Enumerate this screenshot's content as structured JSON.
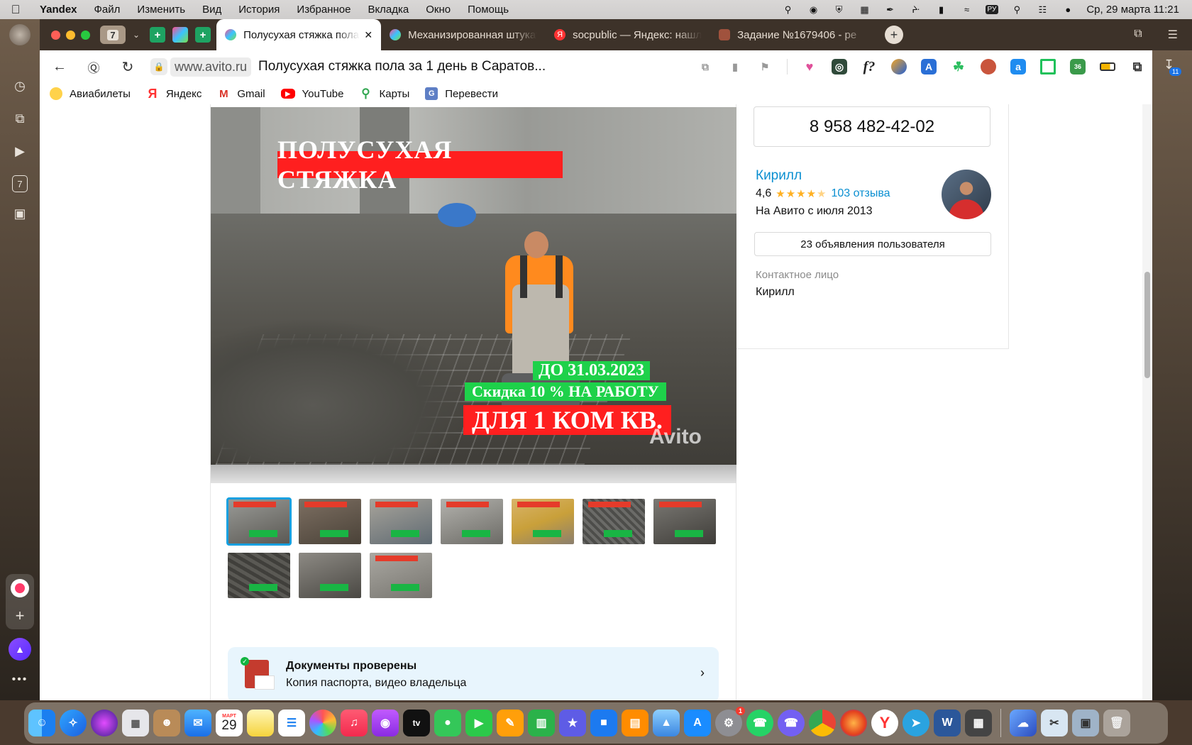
{
  "menubar": {
    "app_name": "Yandex",
    "items": [
      "Файл",
      "Изменить",
      "Вид",
      "История",
      "Избранное",
      "Вкладка",
      "Окно",
      "Помощь"
    ],
    "keyboard_layout": "РУ",
    "datetime": "Ср, 29 марта  11:21"
  },
  "tabs": {
    "count": "7",
    "items": [
      {
        "title": "Полусухая стяжка пола",
        "active": true
      },
      {
        "title": "Механизированная штукатурка",
        "active": false
      },
      {
        "title": "socpublic — Яндекс: нашлось",
        "active": false
      },
      {
        "title": "Задание №1679406 - ре",
        "active": false
      }
    ],
    "new_tab": "+"
  },
  "toolbar": {
    "domain": "www.avito.ru",
    "page_title": "Полусухая стяжка пола за 1 день в Саратов..."
  },
  "bookmarks": [
    {
      "label": "Авиабилеты",
      "icon": "plane-icon"
    },
    {
      "label": "Яндекс",
      "icon": "yandex-icon"
    },
    {
      "label": "Gmail",
      "icon": "gmail-icon"
    },
    {
      "label": "YouTube",
      "icon": "youtube-icon"
    },
    {
      "label": "Карты",
      "icon": "maps-icon"
    },
    {
      "label": "Перевести",
      "icon": "translate-icon"
    }
  ],
  "downloads_badge": "11",
  "listing": {
    "photo": {
      "banner_title": "ПОЛУСУХАЯ СТЯЖКА",
      "promo_date": "ДО 31.03.2023",
      "promo_discount": "Скидка 10 %  НА РАБОТУ",
      "promo_room": "ДЛЯ 1 КОМ КВ.",
      "watermark": "Avito"
    },
    "thumbnail_count": 10,
    "documents": {
      "title": "Документы проверены",
      "subtitle": "Копия паспорта, видео владельца"
    }
  },
  "seller": {
    "phone": "8 958 482-42-02",
    "name": "Кирилл",
    "rating": "4,6",
    "rating_value": 4.6,
    "reviews": "103 отзыва",
    "since": "На Авито с июля 2013",
    "ads_button": "23 объявления пользователя",
    "contact_label": "Контактное лицо",
    "contact_name": "Кирилл"
  },
  "dock": {
    "calendar_month": "МАРТ",
    "calendar_day": "29",
    "settings_badge": "1"
  }
}
